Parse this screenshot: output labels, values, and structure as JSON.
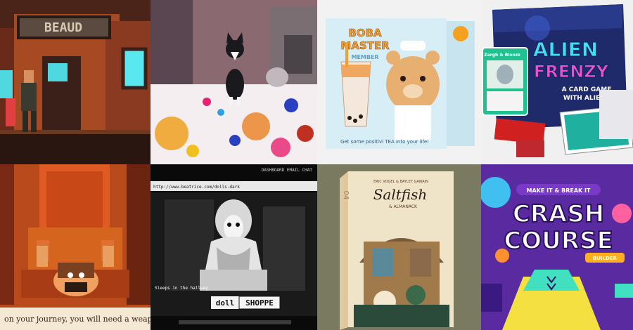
{
  "tiles": {
    "t1": {
      "sign": "BEAUD"
    },
    "t3": {
      "title1": "BOBA",
      "title2": "MASTER",
      "sub": "MEMBER",
      "tagline": "Get some positivi TEA into your life!"
    },
    "t4": {
      "title1": "ALIEN",
      "title2": "FRENZY",
      "sub1": "A CARD GAME",
      "sub2": "WITH ALIENS",
      "card_name": "Zargh & Bloozz"
    },
    "t5": {
      "dialog": "on your journey, you will need a weapon to d"
    },
    "t6": {
      "topbar": "DASHBOARD  EMAIL  CHAT",
      "url": "http://www.beatrice.com/dolls.dark",
      "caption": "Sleeps in the hallway",
      "logo_left": "doll",
      "logo_right": "SHOPPE"
    },
    "t7": {
      "number": "04",
      "authors": "ERIC VOGEL  &  BAYLEY GAWAIN",
      "title": "Saltfish",
      "subtitle": "& ALMANACK"
    },
    "t8": {
      "tagline": "MAKE IT & BREAK IT",
      "title1": "CRASH",
      "title2": "COURSE",
      "badge": "BUILDER"
    }
  },
  "colors": {
    "pixel_bg": "#2a1a14",
    "boba_box": "#dcf0f6",
    "alien_box": "#1e2a6a",
    "throne_bg": "#b84a1c",
    "crash_bg": "#5a2aa0"
  }
}
